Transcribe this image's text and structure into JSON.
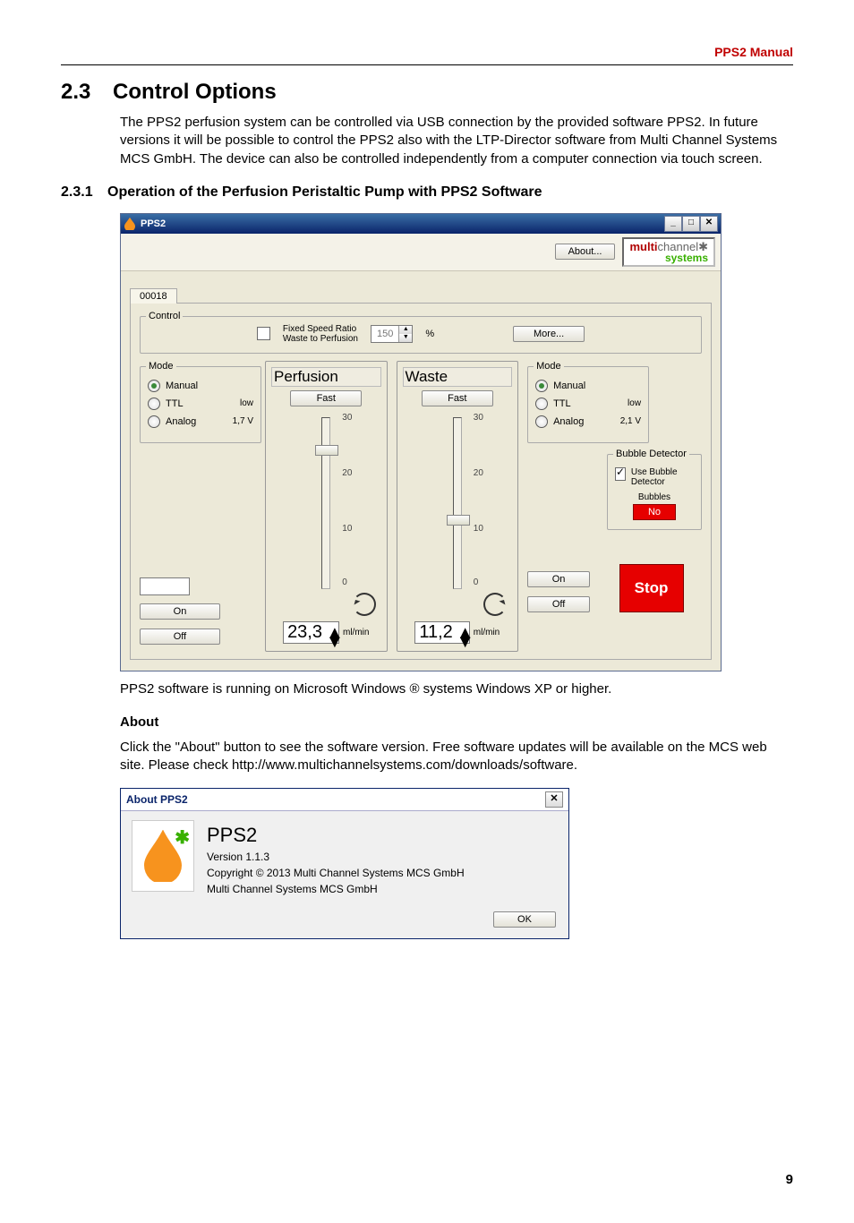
{
  "running_head": "PPS2 Manual",
  "section": {
    "num": "2.3",
    "title": "Control Options"
  },
  "intro": "The PPS2 perfusion system can be controlled via USB connection by the provided software PPS2. In future versions it will be possible to control the PPS2 also with the LTP-Director software from Multi Channel Systems MCS GmbH. The device can also be controlled independently from a computer connection via touch screen.",
  "subsection": {
    "num": "2.3.1",
    "title": "Operation of the Perfusion Peristaltic Pump with PPS2 Software"
  },
  "pps2_win": {
    "title": "PPS2",
    "about_btn": "About...",
    "logo_line1a": "multi",
    "logo_line1b": "channel",
    "logo_line2": "systems",
    "tab": "00018",
    "control": {
      "legend": "Control",
      "fixed_label_l1": "Fixed Speed Ratio",
      "fixed_label_l2": "Waste to Perfusion",
      "fixed_checked": false,
      "ratio_value": "150",
      "ratio_unit": "%",
      "more_btn": "More..."
    },
    "mode_left": {
      "legend": "Mode",
      "options": [
        {
          "label": "Manual",
          "selected": true,
          "value": ""
        },
        {
          "label": "TTL",
          "selected": false,
          "value": "low"
        },
        {
          "label": "Analog",
          "selected": false,
          "value": "1,7 V"
        }
      ]
    },
    "perfusion": {
      "title": "Perfusion",
      "fast_btn": "Fast",
      "scale": [
        "30",
        "20",
        "10",
        "0"
      ],
      "slider_pos_pct": 78,
      "flow_value": "23,3",
      "flow_unit": "ml/min"
    },
    "waste": {
      "title": "Waste",
      "fast_btn": "Fast",
      "scale": [
        "30",
        "20",
        "10",
        "0"
      ],
      "slider_pos_pct": 37,
      "flow_value": "11,2",
      "flow_unit": "ml/min"
    },
    "mode_right": {
      "legend": "Mode",
      "options": [
        {
          "label": "Manual",
          "selected": true,
          "value": ""
        },
        {
          "label": "TTL",
          "selected": false,
          "value": "low"
        },
        {
          "label": "Analog",
          "selected": false,
          "value": "2,1 V"
        }
      ]
    },
    "bubble": {
      "legend": "Bubble Detector",
      "use_label": "Use Bubble Detector",
      "use_checked": true,
      "bubbles_label": "Bubbles",
      "status": "No"
    },
    "left_buttons": {
      "on": "On",
      "off": "Off"
    },
    "right_buttons": {
      "on": "On",
      "off": "Off",
      "stop": "Stop"
    }
  },
  "caption1": "PPS2 software is running on Microsoft Windows ® systems Windows XP or higher.",
  "about_heading": "About",
  "about_para": "Click the \"About\" button to see the software version. Free software updates will be available on the MCS web site. Please check http://www.multichannelsystems.com/downloads/software.",
  "about_win": {
    "title": "About PPS2",
    "product": "PPS2",
    "version": "Version 1.1.3",
    "copyright": "Copyright © 2013 Multi Channel Systems MCS GmbH",
    "company": "Multi Channel Systems MCS GmbH",
    "ok": "OK"
  },
  "page_number": "9"
}
